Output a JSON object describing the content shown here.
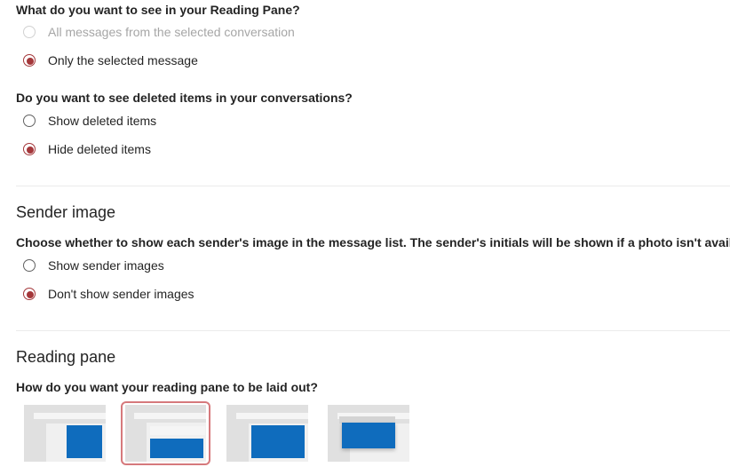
{
  "reading_pane_content": {
    "question": "What do you want to see in your Reading Pane?",
    "options": [
      {
        "label": "All messages from the selected conversation",
        "checked": false,
        "disabled": true
      },
      {
        "label": "Only the selected message",
        "checked": true,
        "disabled": false
      }
    ]
  },
  "deleted_items": {
    "question": "Do you want to see deleted items in your conversations?",
    "options": [
      {
        "label": "Show deleted items",
        "checked": false
      },
      {
        "label": "Hide deleted items",
        "checked": true
      }
    ]
  },
  "sender_image": {
    "title": "Sender image",
    "question": "Choose whether to show each sender's image in the message list. The sender's initials will be shown if a photo isn't available.",
    "options": [
      {
        "label": "Show sender images",
        "checked": false
      },
      {
        "label": "Don't show sender images",
        "checked": true
      }
    ]
  },
  "reading_pane_layout": {
    "title": "Reading pane",
    "question": "How do you want your reading pane to be laid out?",
    "selected_index": 1,
    "options": [
      {
        "icon": "reading-pane-right-icon",
        "selected": false
      },
      {
        "icon": "reading-pane-bottom-icon",
        "selected": true
      },
      {
        "icon": "reading-pane-hidden-icon",
        "selected": false
      },
      {
        "icon": "reading-pane-popup-icon",
        "selected": false
      }
    ]
  },
  "colors": {
    "accent": "#a4373a",
    "selection_border": "#d6797c",
    "preview_blue": "#0f6cbd"
  }
}
